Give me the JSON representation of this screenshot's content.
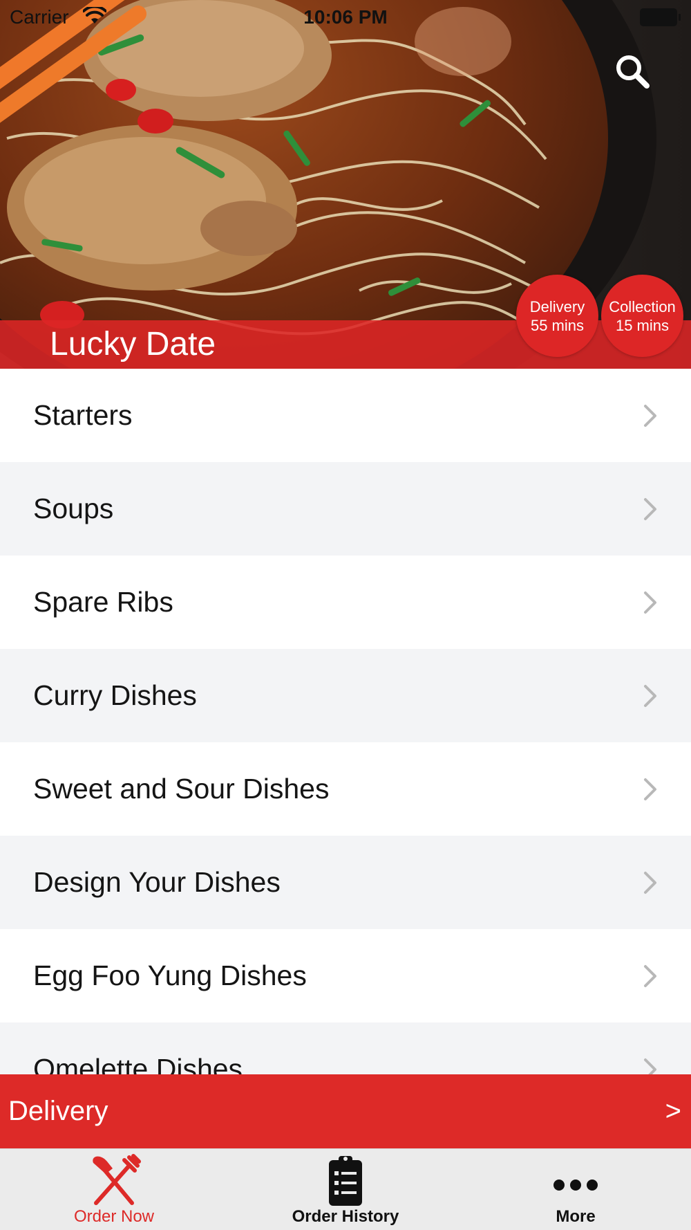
{
  "status_bar": {
    "carrier": "Carrier",
    "time": "10:06 PM",
    "wifi_icon": "wifi-icon",
    "battery_icon": "battery-icon"
  },
  "header": {
    "restaurant_name": "Lucky Date",
    "search_icon": "search-icon",
    "badges": [
      {
        "line1": "Delivery",
        "line2": "55 mins"
      },
      {
        "line1": "Collection",
        "line2": "15 mins"
      }
    ]
  },
  "menu": {
    "categories": [
      "Starters",
      "Soups",
      "Spare Ribs",
      "Curry Dishes",
      "Sweet and Sour Dishes",
      "Design Your Dishes",
      "Egg Foo Yung Dishes",
      "Omelette Dishes"
    ],
    "chevron_icon": "chevron-right-icon"
  },
  "delivery_bar": {
    "label": "Delivery",
    "arrow": ">"
  },
  "tab_bar": {
    "tabs": [
      {
        "label": "Order Now",
        "icon": "fork-knife-icon"
      },
      {
        "label": "Order History",
        "icon": "clipboard-list-icon"
      },
      {
        "label": "More",
        "icon": "more-dots-icon"
      }
    ]
  },
  "colors": {
    "accent": "#dd2a28",
    "row_alt": "#f3f4f6",
    "tab_bar": "#ebebeb"
  }
}
